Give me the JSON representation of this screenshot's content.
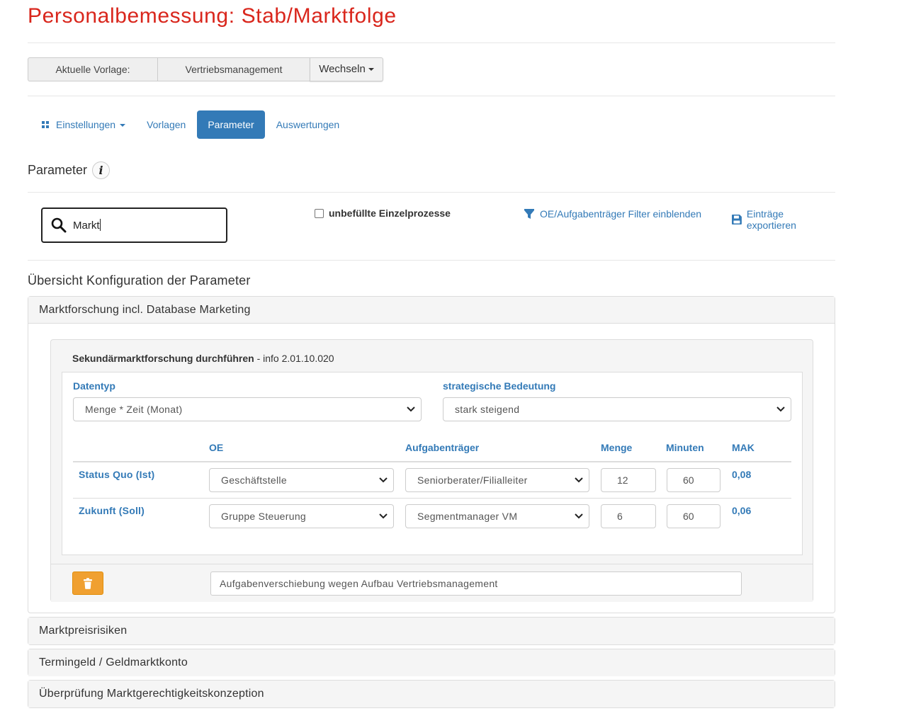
{
  "page": {
    "title": "Personalbemessung: Stab/Marktfolge"
  },
  "vorlage": {
    "label": "Aktuelle Vorlage:",
    "value": "Vertriebsmanagement",
    "switch_label": "Wechseln"
  },
  "nav": {
    "items": [
      {
        "label": "Einstellungen",
        "icon": "grid-icon",
        "dropdown": true
      },
      {
        "label": "Vorlagen"
      },
      {
        "label": "Parameter",
        "active": true
      },
      {
        "label": "Auswertungen"
      }
    ]
  },
  "parameter": {
    "heading": "Parameter",
    "info_icon": "info-icon"
  },
  "toolbar": {
    "search_value": "Markt",
    "search_icon": "search-icon",
    "unfilled_label": "unbefüllte Einzelprozesse",
    "unfilled_checked": false,
    "filter_label": "OE/Aufgabenträger Filter einblenden",
    "filter_icon": "filter-icon",
    "export_label": "Einträge exportieren",
    "export_icon": "floppy-icon"
  },
  "overview": {
    "heading": "Übersicht Konfiguration der Parameter",
    "groups": [
      {
        "title": "Marktforschung incl. Database Marketing",
        "expanded": true
      },
      {
        "title": "Marktpreisrisiken",
        "expanded": false
      },
      {
        "title": "Termingeld / Geldmarktkonto",
        "expanded": false
      },
      {
        "title": "Überprüfung Marktgerechtigkeitskonzeption",
        "expanded": false
      }
    ]
  },
  "process": {
    "name": "Sekundärmarktforschung durchführen",
    "info": " - info 2.01.10.020",
    "datentyp_label": "Datentyp",
    "datentyp_value": "Menge * Zeit (Monat)",
    "bedeutung_label": "strategische Bedeutung",
    "bedeutung_value": "stark steigend",
    "columns": {
      "oe": "OE",
      "traeger": "Aufgabenträger",
      "menge": "Menge",
      "minuten": "Minuten",
      "mak": "MAK"
    },
    "rows": [
      {
        "label": "Status Quo (Ist)",
        "oe": "Geschäftstelle",
        "traeger": "Seniorberater/Filialleiter",
        "menge": "12",
        "minuten": "60",
        "mak": "0,08"
      },
      {
        "label": "Zukunft (Soll)",
        "oe": "Gruppe Steuerung",
        "traeger": "Segmentmanager VM",
        "menge": "6",
        "minuten": "60",
        "mak": "0,06"
      }
    ],
    "delete_icon": "trash-icon",
    "delete_color": "#f0a030",
    "comment": "Aufgabenverschiebung wegen Aufbau Vertriebsmanagement"
  },
  "colors": {
    "title": "#d9261c",
    "link": "#337ab7",
    "active_tab": "#337ab7"
  }
}
